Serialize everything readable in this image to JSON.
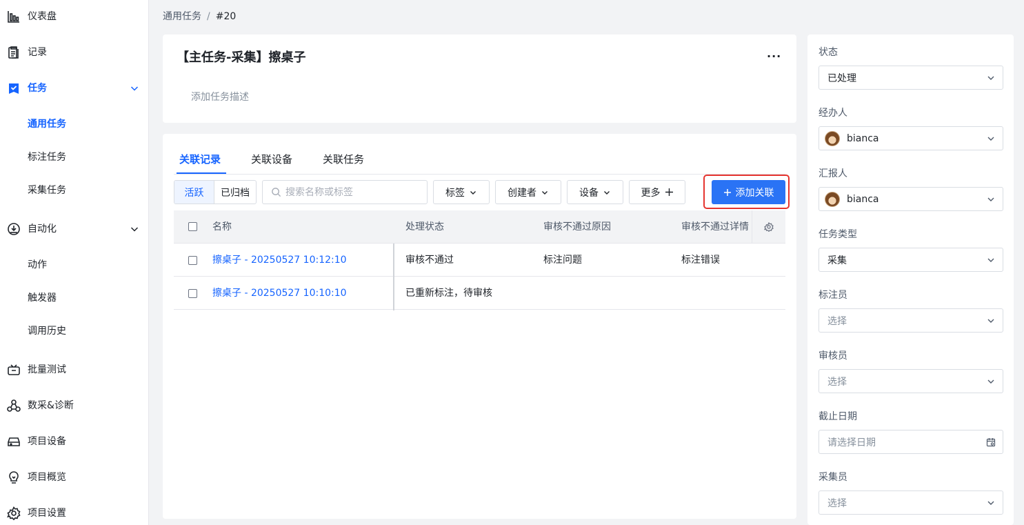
{
  "sidebar": {
    "items": [
      {
        "label": "仪表盘",
        "icon": "bar-chart-icon"
      },
      {
        "label": "记录",
        "icon": "clipboard-icon"
      },
      {
        "label": "任务",
        "icon": "task-icon"
      },
      {
        "label": "通用任务"
      },
      {
        "label": "标注任务"
      },
      {
        "label": "采集任务"
      },
      {
        "label": "自动化",
        "icon": "automation-icon"
      },
      {
        "label": "动作"
      },
      {
        "label": "触发器"
      },
      {
        "label": "调用历史"
      },
      {
        "label": "批量测试",
        "icon": "batch-test-icon"
      },
      {
        "label": "数采&诊断",
        "icon": "diagnosis-icon"
      },
      {
        "label": "项目设备",
        "icon": "device-icon"
      },
      {
        "label": "项目概览",
        "icon": "overview-icon"
      },
      {
        "label": "项目设置",
        "icon": "gear-icon"
      }
    ]
  },
  "breadcrumb": {
    "parent": "通用任务",
    "separator": "/",
    "current": "#20"
  },
  "task": {
    "title": "【主任务-采集】擦桌子",
    "more": "···",
    "description_placeholder": "添加任务描述"
  },
  "tabs": [
    "关联记录",
    "关联设备",
    "关联任务"
  ],
  "toolbar": {
    "segment_active": "活跃",
    "segment_archived": "已归档",
    "search_placeholder": "搜索名称或标签",
    "filter_tags": "标签",
    "filter_creator": "创建者",
    "filter_device": "设备",
    "filter_more": "更多",
    "add_link": "添加关联"
  },
  "table": {
    "columns": [
      "名称",
      "处理状态",
      "审核不通过原因",
      "审核不通过详情"
    ],
    "rows": [
      {
        "name": "擦桌子 - 20250527 10:12:10",
        "status": "审核不通过",
        "reason": "标注问题",
        "detail": "标注错误"
      },
      {
        "name": "擦桌子 - 20250527 10:10:10",
        "status": "已重新标注，待审核",
        "reason": "",
        "detail": ""
      }
    ]
  },
  "panel": {
    "status_label": "状态",
    "status_value": "已处理",
    "assignee_label": "经办人",
    "assignee_value": "bianca",
    "reporter_label": "汇报人",
    "reporter_value": "bianca",
    "type_label": "任务类型",
    "type_value": "采集",
    "annotator_label": "标注员",
    "annotator_placeholder": "选择",
    "reviewer_label": "审核员",
    "reviewer_placeholder": "选择",
    "due_label": "截止日期",
    "due_placeholder": "请选择日期",
    "collector_label": "采集员",
    "collector_placeholder": "选择"
  },
  "colors": {
    "accent": "#1664ff",
    "primary_button": "#2a73f5",
    "highlight_border": "#e5332e"
  }
}
